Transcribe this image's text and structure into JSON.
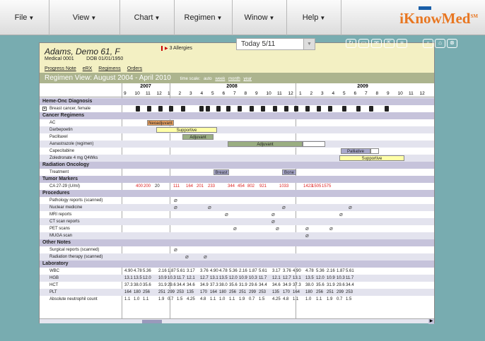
{
  "menus": [
    {
      "label": "File",
      "arrow": "▼"
    },
    {
      "label": "View",
      "arrow": "▼"
    },
    {
      "label": "Chart",
      "arrow": "▼"
    },
    {
      "label": "Regimen",
      "arrow": "▼"
    },
    {
      "label": "Winow",
      "arrow": "▼"
    },
    {
      "label": "Help",
      "arrow": "▼"
    }
  ],
  "logo": {
    "text": "iKnowMed",
    "tm": "SM"
  },
  "patient": {
    "name": "Adams, Demo 61, F",
    "medical": "Medical 0001",
    "dob": "DOB 01/01/1950",
    "allergies": "3 Allergies"
  },
  "tabs": [
    "Progress Note",
    "eRX",
    "Regimens",
    "Orders"
  ],
  "today": "Today 5/11",
  "toolbar_icons": [
    "refresh-icon",
    "print-icon",
    "mail-icon",
    "export-icon",
    "notes-icon",
    "search-icon",
    "home-icon",
    "close-icon"
  ],
  "view": {
    "title": "Regimen View: August 2004 - April 2010",
    "timescale_label": "time scale:",
    "scales": [
      "auto",
      "week",
      "month",
      "year"
    ]
  },
  "years": [
    {
      "label": "2007"
    },
    {
      "label": "2008"
    },
    {
      "label": "2009"
    }
  ],
  "months": [
    "9",
    "10",
    "11",
    "12",
    "1",
    "2",
    "3",
    "4",
    "5",
    "6",
    "7",
    "8",
    "9",
    "10",
    "11",
    "12",
    "1",
    "2",
    "3",
    "4",
    "5",
    "6",
    "7",
    "8",
    "9",
    "10",
    "11",
    "12"
  ],
  "sections": {
    "heme": "Heme-Onc Diagnosis",
    "regimens": "Cancer Regimens",
    "radiation": "Radiation Oncology",
    "tumor": "Tumor Markers",
    "procedures": "Procedures",
    "other": "Other Notes",
    "lab": "Laboratory"
  },
  "rows": {
    "diag": "Breast cancer, female",
    "ac": "AC",
    "darb": "Darbepoetin",
    "pacl": "Paclitaxel",
    "anas": "Aanastrazole (regimen)",
    "cape": "Capecitabine",
    "zole": "Zoledronate 4 mg Q4Wks",
    "treat": "Treatment",
    "ca": "CA 27-29 (U/ml)",
    "path": "Pathology reports (scanned)",
    "nuc": "Nuclear medicine",
    "mri": "MRI reports",
    "ct": "CT scan reports",
    "pet": "PET scans",
    "muga": "MUGA scan",
    "surg": "Surgical reports (scanned)",
    "radt": "Radiation therapy (scanned)",
    "wbc": "WBC",
    "hgb": "HGB",
    "hct": "HCT",
    "plt": "PLT",
    "anc": "Absolute neutrophil count"
  },
  "bars": {
    "neo": "Neoadjuvant",
    "supp1": "Supportive",
    "adj1": "Adjuvant",
    "adj2": "Adjuvant",
    "pall": "Palliative",
    "supp2": "Supportive",
    "breast": "Breast",
    "bone": "Bone"
  },
  "tumor_values": [
    "400",
    "200",
    "20",
    "111",
    "164",
    "201",
    "233",
    "344",
    "454",
    "802",
    "921",
    "1033",
    "1423",
    "1505",
    "1575"
  ],
  "labs": {
    "wbc": [
      "4.90",
      "4.78",
      "5.36",
      "2.16",
      "1.87",
      "5.61",
      "3.17",
      "3.76",
      "4.90",
      "4.78",
      "5.36",
      "2.16",
      "1.87",
      "5.61",
      "3.17",
      "3.76",
      "4.90",
      "4.78",
      "5.36",
      "2.16",
      "1.87",
      "5.61"
    ],
    "hgb": [
      "13.1",
      "13.5",
      "12.0",
      "10.9",
      "10.3",
      "11.7",
      "12.1",
      "12.7",
      "13.1",
      "13.5",
      "12.0",
      "10.9",
      "10.3",
      "11.7",
      "12.1",
      "12.7",
      "13.1",
      "13.5",
      "12.0",
      "10.9",
      "10.3",
      "11.7"
    ],
    "hct": [
      "37.3",
      "38.0",
      "35.6",
      "31.9",
      "29.6",
      "34.4",
      "34.6",
      "34.9",
      "37.3",
      "38.0",
      "35.6",
      "31.9",
      "29.6",
      "34.4",
      "34.6",
      "34.9",
      "37.3",
      "38.0",
      "35.6",
      "31.9",
      "29.6",
      "34.4"
    ],
    "plt": [
      "164",
      "180",
      "256",
      "251",
      "299",
      "253",
      "135",
      "170",
      "164",
      "180",
      "256",
      "251",
      "299",
      "253",
      "135",
      "170",
      "164",
      "180",
      "256",
      "251",
      "299",
      "253"
    ],
    "anc": [
      "1.1",
      "1.0",
      "1.1",
      "1.9",
      "0.7",
      "1.5",
      "4.25",
      "4.8",
      "1.1",
      "1.0",
      "1.1",
      "1.9",
      "0.7",
      "1.5",
      "4.25",
      "4.8",
      "1.1",
      "1.0",
      "1.1",
      "1.9",
      "0.7",
      "1.5"
    ]
  },
  "colors": {
    "neo": "#e8a060",
    "supp": "#ffffa8",
    "adj": "#9aae82",
    "pall": "#a8a8cc",
    "bone": "#a8a8cc"
  }
}
